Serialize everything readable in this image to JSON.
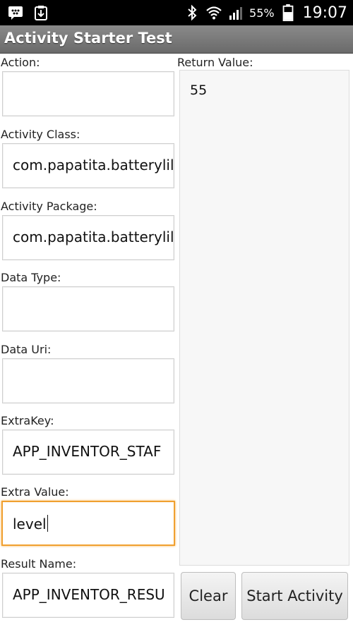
{
  "status_bar": {
    "left_icons": [
      "bbm-icon",
      "download-icon"
    ],
    "battery_pct": "55%",
    "time": "19:07"
  },
  "app": {
    "title": "Activity Starter Test"
  },
  "form": {
    "action": {
      "label": "Action:",
      "value": ""
    },
    "activity_class": {
      "label": "Activity Class:",
      "value": "com.papatita.batterylil"
    },
    "activity_package": {
      "label": "Activity Package:",
      "value": "com.papatita.batterylil"
    },
    "data_type": {
      "label": "Data Type:",
      "value": ""
    },
    "data_uri": {
      "label": "Data Uri:",
      "value": ""
    },
    "extra_key": {
      "label": "ExtraKey:",
      "value": "APP_INVENTOR_STAF"
    },
    "extra_value": {
      "label": "Extra Value:",
      "value": "level"
    },
    "result_name": {
      "label": "Result Name:",
      "value": "APP_INVENTOR_RESU"
    }
  },
  "return_value": {
    "label": "Return Value:",
    "value": "55"
  },
  "buttons": {
    "clear": "Clear",
    "start": "Start Activity"
  },
  "colors": {
    "focus_border": "#f0a030",
    "titlebar": "#7a7a7a"
  }
}
